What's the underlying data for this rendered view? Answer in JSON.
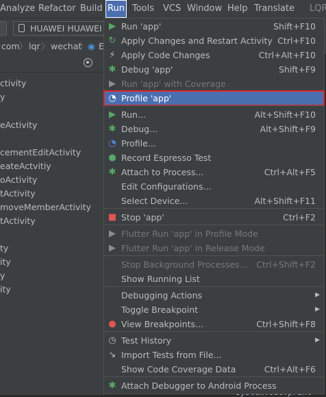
{
  "menubar": {
    "items": [
      "Analyze",
      "Refactor",
      "Build",
      "Run",
      "Tools",
      "VCS",
      "Window",
      "Help",
      "Translate",
      "LQR"
    ]
  },
  "toolbar": {
    "device": "HUAWEI HUAWEI M"
  },
  "breadcrumbs": {
    "items": [
      "com",
      "lqr",
      "wechat",
      "E"
    ]
  },
  "tree": {
    "items": [
      "ctivity",
      "y",
      "eActivity",
      "cementEditActivity",
      "eateActvitiy",
      "oActivity",
      "tActivity",
      "moveMemberActivity",
      "tActivity",
      "ty",
      "ity",
      "y",
      "ity"
    ]
  },
  "code_peek": "System.out.print",
  "run_menu": {
    "items": [
      {
        "label": "Run 'app'",
        "shortcut": "Shift+F10",
        "icon": "run-icon"
      },
      {
        "label": "Apply Changes and Restart Activity",
        "shortcut": "Ctrl+F10",
        "icon": "apply-changes-icon"
      },
      {
        "label": "Apply Code Changes",
        "shortcut": "Ctrl+Alt+F10",
        "icon": "apply-code-changes-icon"
      },
      {
        "label": "Debug 'app'",
        "shortcut": "Shift+F9",
        "icon": "debug-icon"
      },
      {
        "label": "Run 'app' with Coverage",
        "shortcut": "",
        "icon": "coverage-icon"
      },
      {
        "label": "Profile 'app'",
        "shortcut": "",
        "icon": "profile-icon"
      },
      {
        "label": "Run...",
        "shortcut": "Alt+Shift+F10",
        "icon": "run-icon"
      },
      {
        "label": "Debug...",
        "shortcut": "Alt+Shift+F9",
        "icon": "debug-icon"
      },
      {
        "label": "Profile...",
        "shortcut": "",
        "icon": "profile-icon"
      },
      {
        "label": "Record Espresso Test",
        "shortcut": "",
        "icon": "record-icon"
      },
      {
        "label": "Attach to Process...",
        "shortcut": "Ctrl+Alt+F5",
        "icon": "attach-icon"
      },
      {
        "label": "Edit Configurations...",
        "shortcut": "",
        "icon": ""
      },
      {
        "label": "Select Device...",
        "shortcut": "Alt+Shift+F11",
        "icon": ""
      },
      {
        "label": "Stop 'app'",
        "shortcut": "Ctrl+F2",
        "icon": "stop-icon"
      },
      {
        "label": "Flutter Run 'app' in Profile Mode",
        "shortcut": "",
        "icon": "flutter-run-icon"
      },
      {
        "label": "Flutter Run 'app' in Release Mode",
        "shortcut": "",
        "icon": "flutter-run-icon"
      },
      {
        "label": "Stop Background Processes...",
        "shortcut": "Ctrl+Shift+F2",
        "icon": ""
      },
      {
        "label": "Show Running List",
        "shortcut": "",
        "icon": ""
      },
      {
        "label": "Debugging Actions",
        "shortcut": "",
        "icon": ""
      },
      {
        "label": "Toggle Breakpoint",
        "shortcut": "",
        "icon": ""
      },
      {
        "label": "View Breakpoints...",
        "shortcut": "Ctrl+Shift+F8",
        "icon": "breakpoints-icon"
      },
      {
        "label": "Test History",
        "shortcut": "",
        "icon": "history-icon"
      },
      {
        "label": "Import Tests from File...",
        "shortcut": "",
        "icon": "import-icon"
      },
      {
        "label": "Show Code Coverage Data",
        "shortcut": "Ctrl+Alt+F6",
        "icon": ""
      },
      {
        "label": "Attach Debugger to Android Process",
        "shortcut": "",
        "icon": "attach-debugger-icon"
      }
    ]
  }
}
